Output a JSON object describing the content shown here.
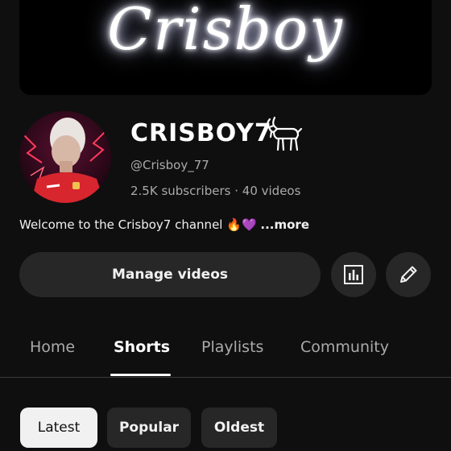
{
  "banner": {
    "text": "Crisboy"
  },
  "channel": {
    "name": "CRISBOY7",
    "badge_icon": "goat-icon",
    "handle": "@Crisboy_77",
    "subscribers": "2.5K subscribers",
    "separator": "·",
    "videos": "40 videos",
    "description": "Welcome to the Crisboy7 channel",
    "description_emoji_1": "🔥",
    "description_emoji_2": "💜",
    "more_label": "...more"
  },
  "actions": {
    "manage_label": "Manage videos",
    "analytics_icon": "analytics-icon",
    "edit_icon": "pencil-icon"
  },
  "tabs": [
    {
      "label": "Home",
      "active": false
    },
    {
      "label": "Shorts",
      "active": true
    },
    {
      "label": "Playlists",
      "active": false
    },
    {
      "label": "Community",
      "active": false
    }
  ],
  "filters": [
    {
      "label": "Latest",
      "selected": true
    },
    {
      "label": "Popular",
      "selected": false
    },
    {
      "label": "Oldest",
      "selected": false
    }
  ],
  "colors": {
    "background": "#0f0f0f",
    "surface": "#272727",
    "text_primary": "#f1f1f1",
    "text_secondary": "#aaaaaa",
    "jersey_red": "#d7262e"
  }
}
